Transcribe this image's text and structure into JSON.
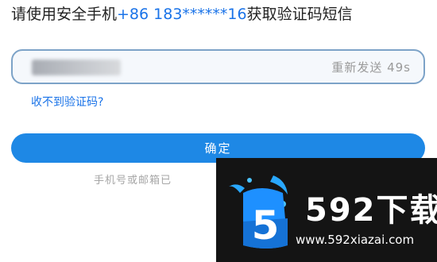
{
  "prompt": {
    "lead": "请使用安全手机",
    "phone": "+86 183******16",
    "trail": "获取验证码短信"
  },
  "code_field": {
    "resend_label": "重新发送 49s"
  },
  "no_code_link": "收不到验证码?",
  "confirm_button": "确定",
  "hint": "手机号或邮箱已",
  "watermark": {
    "logo_digit": "5",
    "title": "592下载",
    "url": "www.592xiazai.com"
  },
  "colors": {
    "accent": "#1e88e5",
    "link": "#1a73e8",
    "watermark_bg": "#141414"
  }
}
